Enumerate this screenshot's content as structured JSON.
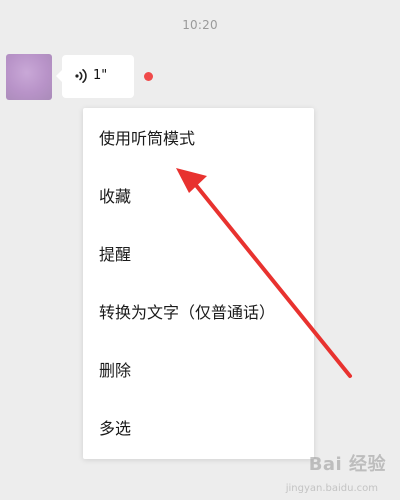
{
  "chat": {
    "timestamp": "10:20",
    "voice_message": {
      "icon": "voice-wave-icon",
      "duration": "1\""
    },
    "unread_indicator_color": "#f04a4a"
  },
  "context_menu": {
    "items": [
      {
        "label": "使用听筒模式"
      },
      {
        "label": "收藏"
      },
      {
        "label": "提醒"
      },
      {
        "label": "转换为文字（仅普通话）"
      },
      {
        "label": "删除"
      },
      {
        "label": "多选"
      }
    ]
  },
  "annotation": {
    "arrow_color": "#e8322f"
  },
  "watermark": {
    "text": "Bai 经验",
    "subtext": "jingyan.baidu.com"
  }
}
